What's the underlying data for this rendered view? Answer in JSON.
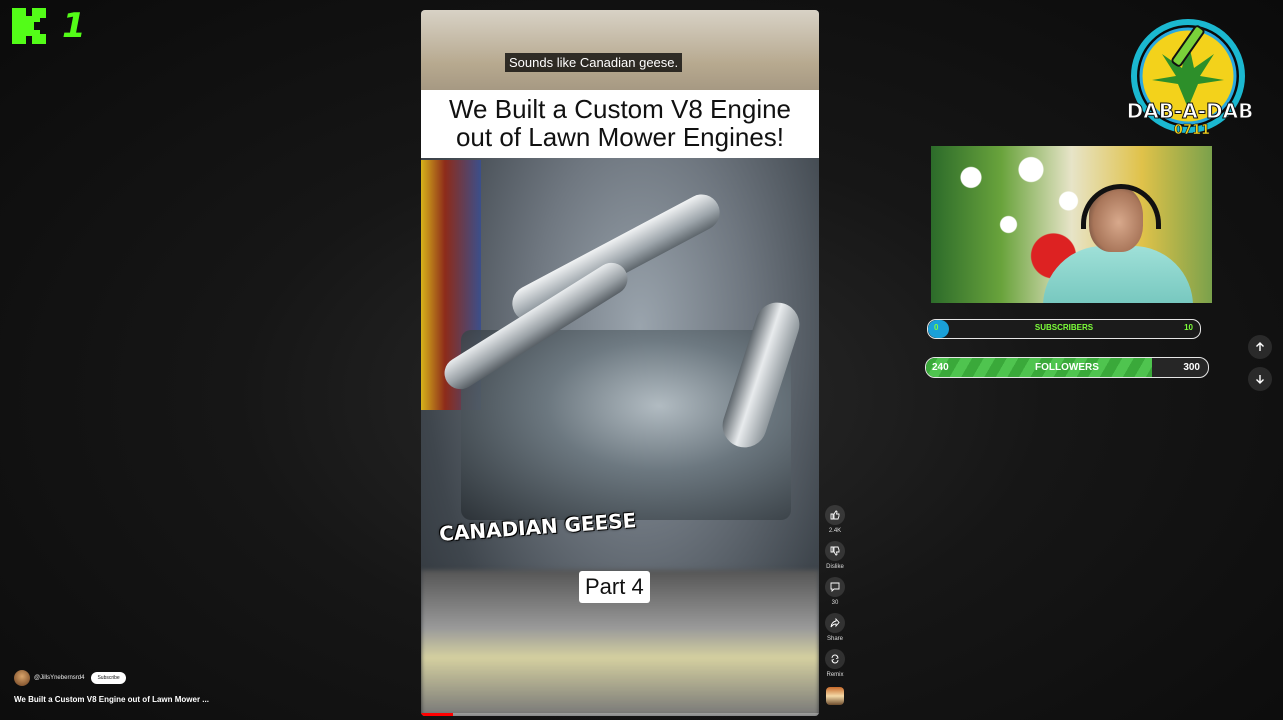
{
  "brand": {
    "logo_icon": "kick-k-icon",
    "logo_number": "1",
    "accent": "#53fc18"
  },
  "video": {
    "caption": "Sounds like Canadian geese.",
    "title_card_line1": "We Built a Custom V8 Engine",
    "title_card_line2": "out of Lawn Mower Engines!",
    "overlay_text": "CANADIAN GEESE",
    "part_label": "Part 4",
    "progress_fraction": 0.08
  },
  "actions": {
    "like_count": "2.4K",
    "dislike_label": "Dislike",
    "comment_count": "30",
    "share_label": "Share",
    "remix_label": "Remix"
  },
  "channel": {
    "handle": "@JillsYnebernsrd4",
    "subscribe_label": "Subscribe",
    "video_title": "We Built a Custom V8 Engine out of Lawn Mower ..."
  },
  "overlay": {
    "logo_text": "DAB-A-DAB",
    "logo_subtext": "0711",
    "subscribers": {
      "current": "0",
      "label": "SUBSCRIBERS",
      "goal": "10",
      "fraction": 0.04
    },
    "followers": {
      "current": "240",
      "label": "FOLLOWERS",
      "goal": "300",
      "fraction": 0.8
    }
  },
  "nav": {
    "up_icon": "arrow-up-icon",
    "down_icon": "arrow-down-icon"
  }
}
